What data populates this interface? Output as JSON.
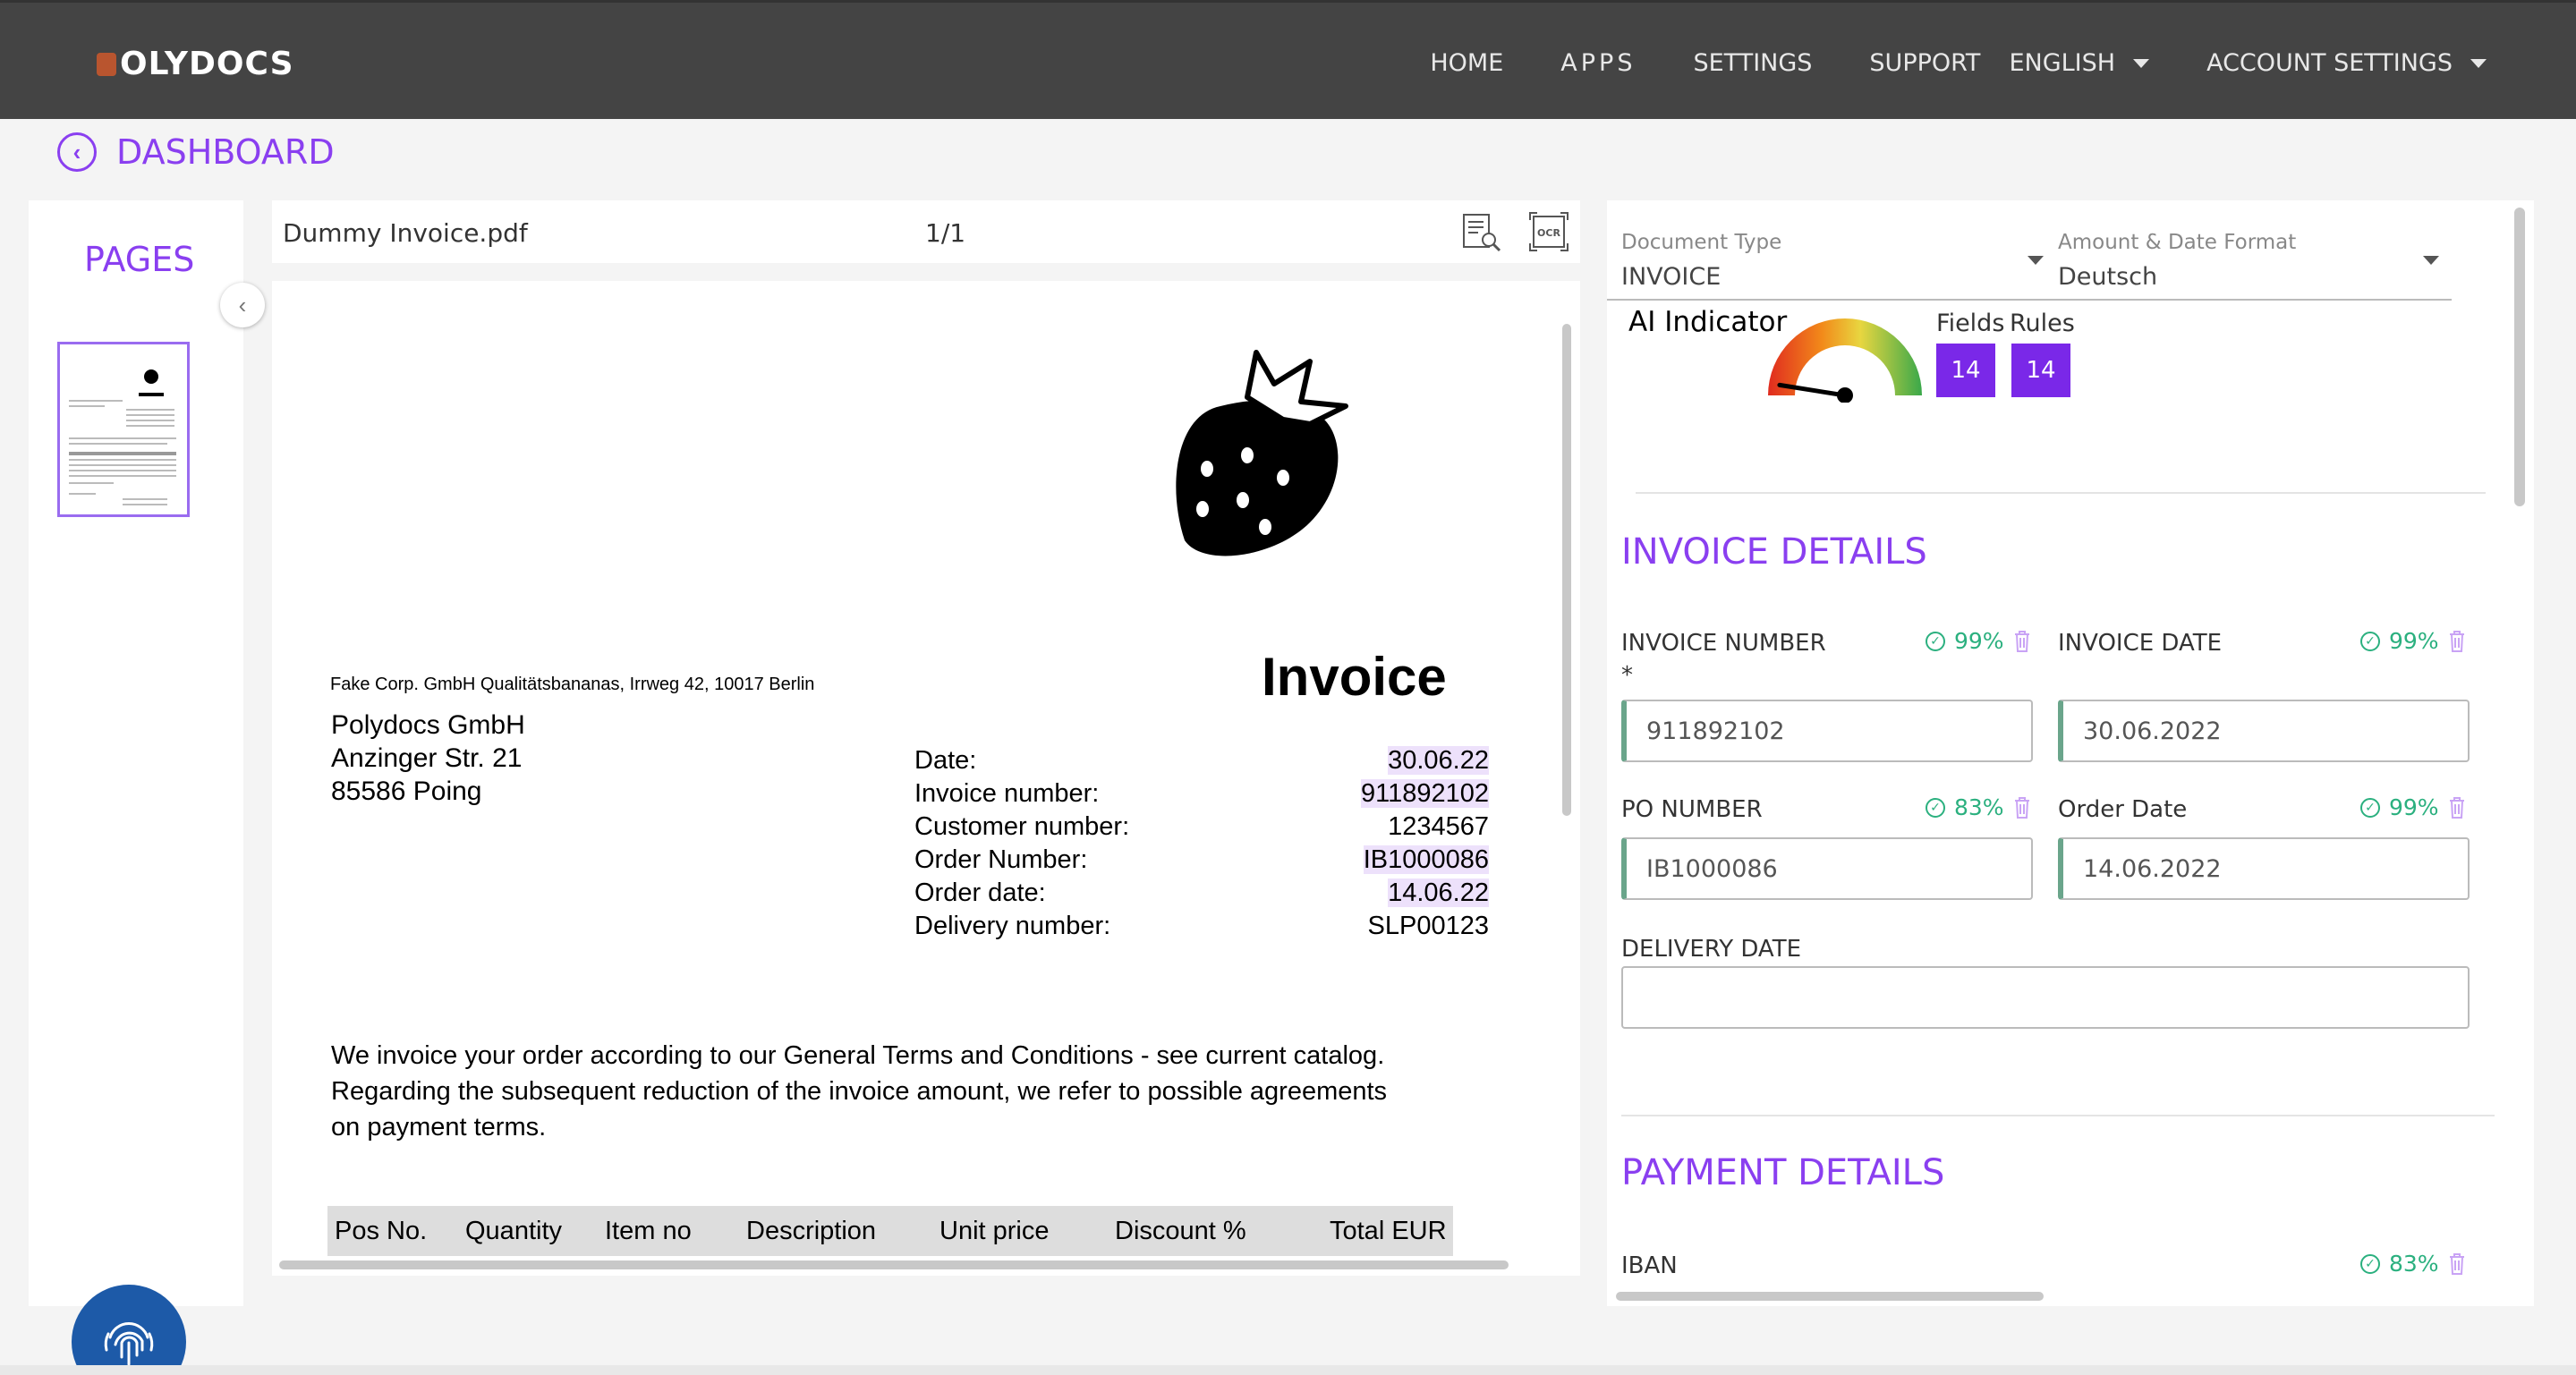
{
  "header": {
    "logo_text": "OLYDOCS",
    "nav": {
      "home": "HOME",
      "apps": "APPS",
      "settings": "SETTINGS",
      "support": "SUPPORT",
      "language": "ENGLISH",
      "account": "ACCOUNT SETTINGS"
    }
  },
  "breadcrumb": {
    "back_label": "DASHBOARD"
  },
  "pages_panel": {
    "title": "PAGES"
  },
  "viewer": {
    "file_name": "Dummy Invoice.pdf",
    "page_indicator": "1/1",
    "icons": [
      "document-search-icon",
      "ocr-icon"
    ]
  },
  "document": {
    "sender_line": "Fake Corp. GmbH Qualitätsbananas, Irrweg 42, 10017 Berlin",
    "heading": "Invoice",
    "recipient": [
      "Polydocs GmbH",
      "Anzinger Str. 21",
      "85586 Poing"
    ],
    "meta_labels": [
      "Date:",
      "Invoice number:",
      "Customer number:",
      "Order Number:",
      "Order date:",
      "Delivery number:"
    ],
    "meta_values": [
      "30.06.22",
      "911892102",
      "1234567",
      "IB1000086",
      "14.06.22",
      "SLP00123"
    ],
    "paragraph": "We invoice your order according to our General Terms and Conditions - see current catalog. Regarding the subsequent reduction of the invoice amount, we refer to possible agreements on payment terms.",
    "table_headers": [
      "Pos No.",
      "Quantity",
      "Item no",
      "Description",
      "Unit price",
      "Discount %",
      "Total EUR"
    ]
  },
  "details": {
    "document_type_label": "Document Type",
    "document_type_value": "INVOICE",
    "format_label": "Amount & Date Format",
    "format_value": "Deutsch",
    "ai_indicator_label": "AI Indicator",
    "fields_label": "Fields",
    "fields_count": "14",
    "rules_label": "Rules",
    "rules_count": "14",
    "gauge_level": 0.05,
    "invoice_section_title": "INVOICE DETAILS",
    "invoice_number_label": "INVOICE NUMBER",
    "invoice_number_required": "*",
    "invoice_number_conf": "99%",
    "invoice_number_value": "911892102",
    "invoice_date_label": "INVOICE DATE",
    "invoice_date_conf": "99%",
    "invoice_date_value": "30.06.2022",
    "po_number_label": "PO NUMBER",
    "po_number_conf": "83%",
    "po_number_value": "IB1000086",
    "order_date_label": "Order Date",
    "order_date_conf": "99%",
    "order_date_value": "14.06.2022",
    "delivery_date_label": "DELIVERY DATE",
    "delivery_date_value": "",
    "payment_section_title": "PAYMENT DETAILS",
    "iban_label": "IBAN",
    "iban_conf": "83%"
  },
  "colors": {
    "accent": "#8a3ff0",
    "badge": "#7a28e8",
    "confidence": "#2bb07f",
    "topbar": "#444444",
    "fab": "#1d5aa8"
  }
}
